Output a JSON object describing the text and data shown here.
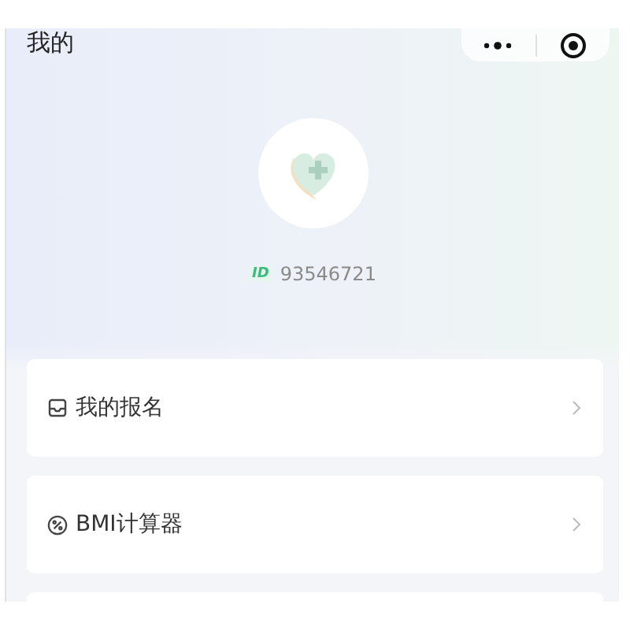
{
  "header": {
    "title": "我的"
  },
  "profile": {
    "id_label": "ID",
    "id_value": "93546721"
  },
  "menu": [
    {
      "kind": "inbox",
      "label": "我的报名"
    },
    {
      "kind": "bmi",
      "label": "BMI计算器"
    }
  ]
}
